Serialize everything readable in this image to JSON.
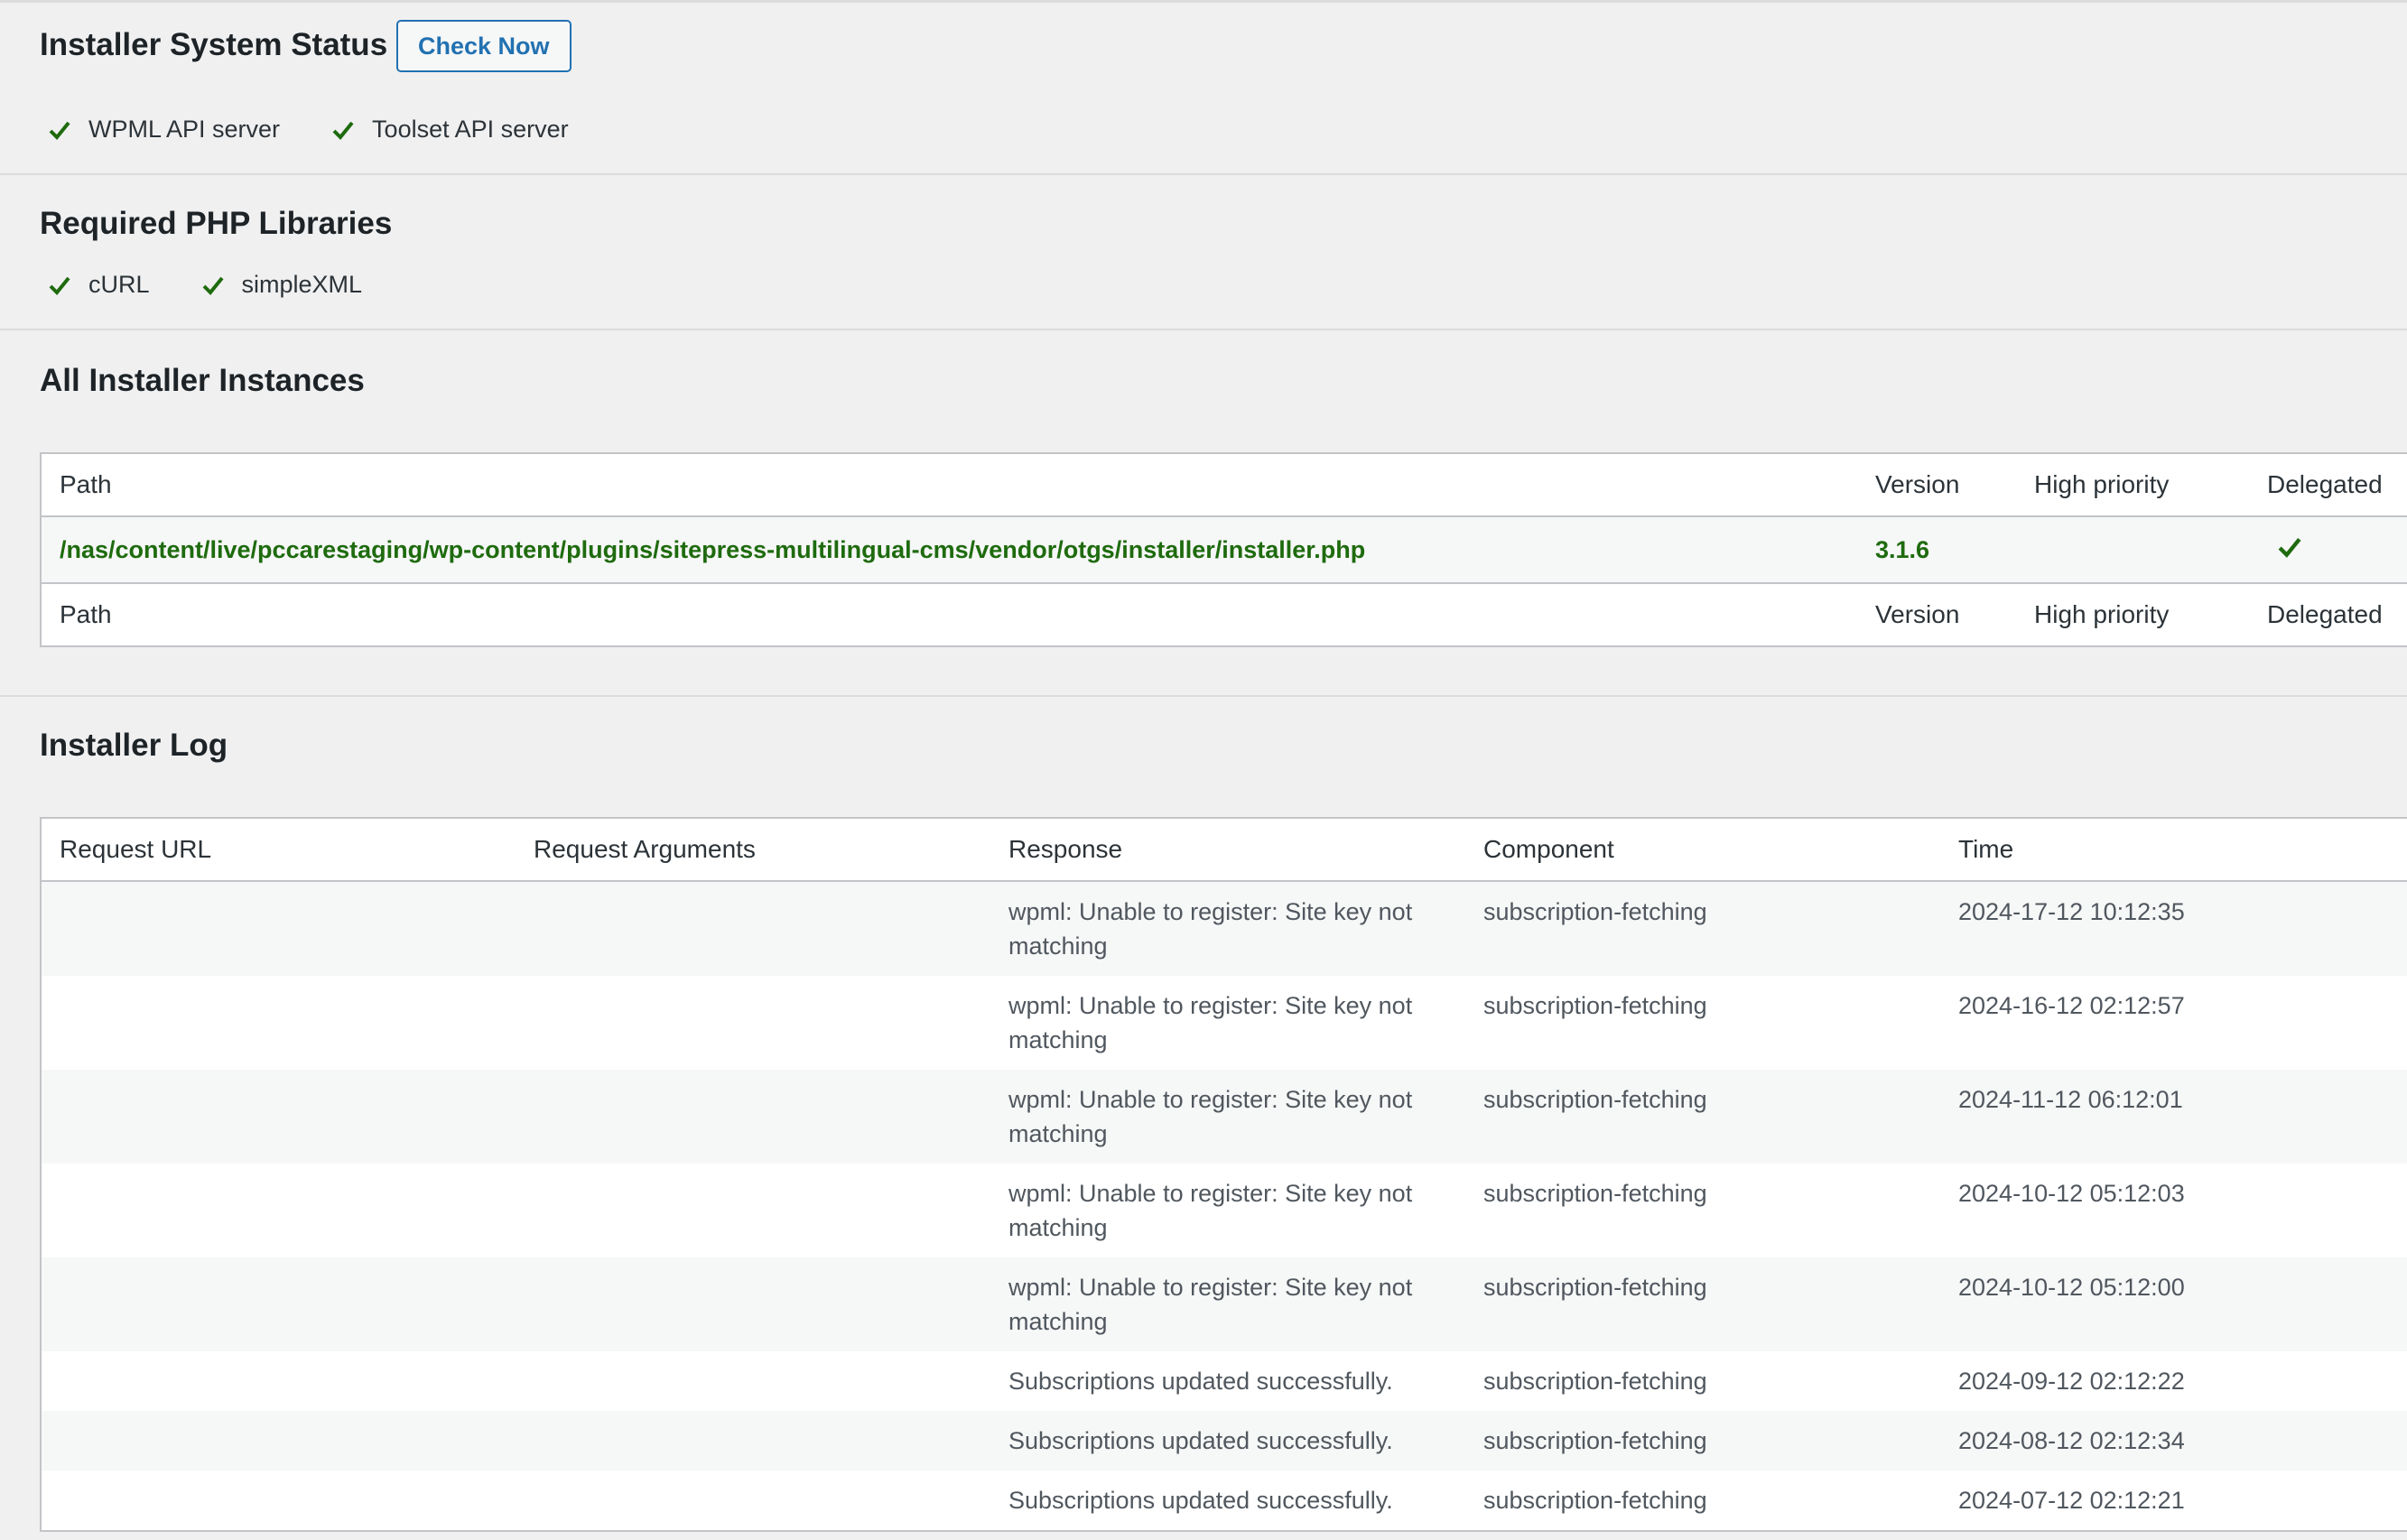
{
  "system_status": {
    "title": "Installer System Status",
    "check_now_label": "Check Now",
    "servers": [
      {
        "label": "WPML API server",
        "icon": "check-icon"
      },
      {
        "label": "Toolset API server",
        "icon": "check-icon"
      }
    ]
  },
  "php_libraries": {
    "title": "Required PHP Libraries",
    "items": [
      {
        "label": "cURL",
        "icon": "check-icon"
      },
      {
        "label": "simpleXML",
        "icon": "check-icon"
      }
    ]
  },
  "instances": {
    "title": "All Installer Instances",
    "columns": {
      "path": "Path",
      "version": "Version",
      "high_priority": "High priority",
      "delegated": "Delegated"
    },
    "rows": [
      {
        "path": "/nas/content/live/pccarestaging/wp-content/plugins/sitepress-multilingual-cms/vendor/otgs/installer/installer.php",
        "version": "3.1.6",
        "high_priority": "",
        "delegated_icon": "check-icon"
      }
    ]
  },
  "log": {
    "title": "Installer Log",
    "columns": {
      "request_url": "Request URL",
      "request_arguments": "Request Arguments",
      "response": "Response",
      "component": "Component",
      "time": "Time"
    },
    "rows": [
      {
        "request_url": "",
        "request_arguments": "",
        "response": "wpml: Unable to register: Site key not matching",
        "component": "subscription-fetching",
        "time": "2024-17-12 10:12:35"
      },
      {
        "request_url": "",
        "request_arguments": "",
        "response": "wpml: Unable to register: Site key not matching",
        "component": "subscription-fetching",
        "time": "2024-16-12 02:12:57"
      },
      {
        "request_url": "",
        "request_arguments": "",
        "response": "wpml: Unable to register: Site key not matching",
        "component": "subscription-fetching",
        "time": "2024-11-12 06:12:01"
      },
      {
        "request_url": "",
        "request_arguments": "",
        "response": "wpml: Unable to register: Site key not matching",
        "component": "subscription-fetching",
        "time": "2024-10-12 05:12:03"
      },
      {
        "request_url": "",
        "request_arguments": "",
        "response": "wpml: Unable to register: Site key not matching",
        "component": "subscription-fetching",
        "time": "2024-10-12 05:12:00"
      },
      {
        "request_url": "",
        "request_arguments": "",
        "response": "Subscriptions updated successfully.",
        "component": "subscription-fetching",
        "time": "2024-09-12 02:12:22"
      },
      {
        "request_url": "",
        "request_arguments": "",
        "response": "Subscriptions updated successfully.",
        "component": "subscription-fetching",
        "time": "2024-08-12 02:12:34"
      },
      {
        "request_url": "",
        "request_arguments": "",
        "response": "Subscriptions updated successfully.",
        "component": "subscription-fetching",
        "time": "2024-07-12 02:12:21"
      }
    ]
  },
  "colors": {
    "accent": "#2271b1",
    "success": "#1e6b0e",
    "background": "#f0f0f1"
  }
}
